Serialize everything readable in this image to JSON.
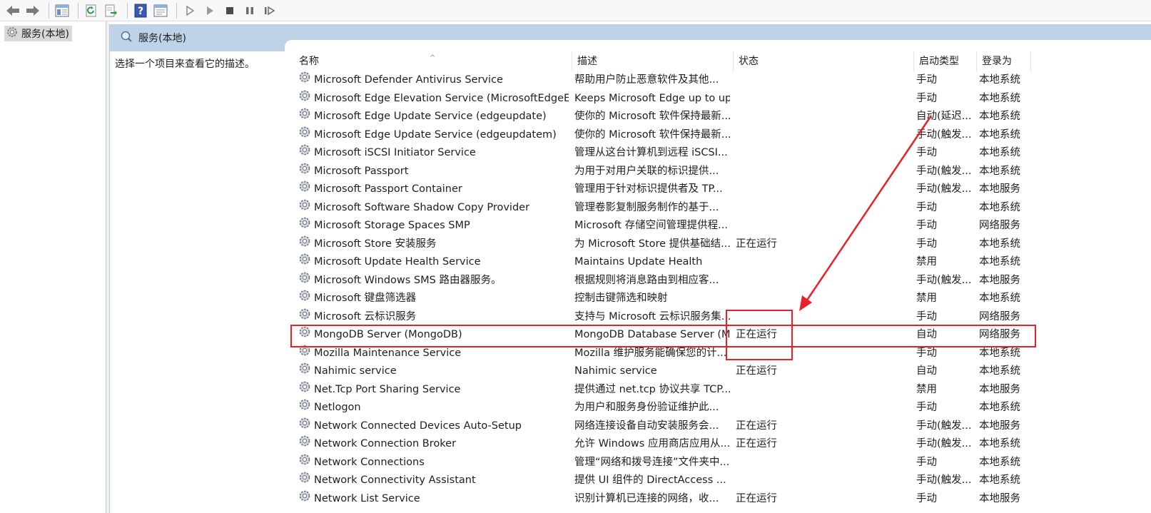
{
  "toolbar": {
    "buttons": [
      "back-icon",
      "forward-icon",
      "show-hide-tree-icon",
      "refresh-icon",
      "export-list-icon",
      "help-icon",
      "properties-icon",
      "start-icon",
      "start-alt-icon",
      "stop-icon",
      "pause-icon",
      "resume-icon"
    ]
  },
  "tree": {
    "root_label": "服务(本地)"
  },
  "panel": {
    "title": "服务(本地)",
    "description_hint": "选择一个项目来查看它的描述。"
  },
  "columns": {
    "name": "名称",
    "description": "描述",
    "status": "状态",
    "startup_type": "启动类型",
    "logon_as": "登录为"
  },
  "rows": [
    {
      "name": "Microsoft Defender Antivirus Service",
      "description": "帮助用户防止恶意软件及其他...",
      "status": "",
      "startup": "手动",
      "logon": "本地系统"
    },
    {
      "name": "Microsoft Edge Elevation Service (MicrosoftEdgeElev...",
      "description": "Keeps Microsoft Edge up to up...",
      "status": "",
      "startup": "手动",
      "logon": "本地系统"
    },
    {
      "name": "Microsoft Edge Update Service (edgeupdate)",
      "description": "使你的 Microsoft 软件保持最新...",
      "status": "",
      "startup": "自动(延迟...",
      "logon": "本地系统"
    },
    {
      "name": "Microsoft Edge Update Service (edgeupdatem)",
      "description": "使你的 Microsoft 软件保持最新...",
      "status": "",
      "startup": "手动(触发...",
      "logon": "本地系统"
    },
    {
      "name": "Microsoft iSCSI Initiator Service",
      "description": "管理从这台计算机到远程 iSCSI...",
      "status": "",
      "startup": "手动",
      "logon": "本地系统"
    },
    {
      "name": "Microsoft Passport",
      "description": "为用于对用户关联的标识提供...",
      "status": "",
      "startup": "手动(触发...",
      "logon": "本地系统"
    },
    {
      "name": "Microsoft Passport Container",
      "description": "管理用于针对标识提供者及 TP...",
      "status": "",
      "startup": "手动(触发...",
      "logon": "本地服务"
    },
    {
      "name": "Microsoft Software Shadow Copy Provider",
      "description": "管理卷影复制服务制作的基于...",
      "status": "",
      "startup": "手动",
      "logon": "本地系统"
    },
    {
      "name": "Microsoft Storage Spaces SMP",
      "description": "Microsoft 存储空间管理提供程...",
      "status": "",
      "startup": "手动",
      "logon": "网络服务"
    },
    {
      "name": "Microsoft Store 安装服务",
      "description": "为 Microsoft Store 提供基础结...",
      "status": "正在运行",
      "startup": "手动",
      "logon": "本地系统"
    },
    {
      "name": "Microsoft Update Health Service",
      "description": "Maintains Update Health",
      "status": "",
      "startup": "禁用",
      "logon": "本地系统"
    },
    {
      "name": "Microsoft Windows SMS 路由器服务。",
      "description": "根据规则将消息路由到相应客...",
      "status": "",
      "startup": "手动(触发...",
      "logon": "本地服务"
    },
    {
      "name": "Microsoft 键盘筛选器",
      "description": "控制击键筛选和映射",
      "status": "",
      "startup": "禁用",
      "logon": "本地系统"
    },
    {
      "name": "Microsoft 云标识服务",
      "description": "支持与 Microsoft 云标识服务集...",
      "status": "",
      "startup": "手动",
      "logon": "网络服务"
    },
    {
      "name": "MongoDB Server (MongoDB)",
      "description": "MongoDB Database Server (M...",
      "status": "正在运行",
      "startup": "自动",
      "logon": "网络服务"
    },
    {
      "name": "Mozilla Maintenance Service",
      "description": "Mozilla 维护服务能确保您的计...",
      "status": "",
      "startup": "手动",
      "logon": "本地系统"
    },
    {
      "name": "Nahimic service",
      "description": "Nahimic service",
      "status": "正在运行",
      "startup": "自动",
      "logon": "本地系统"
    },
    {
      "name": "Net.Tcp Port Sharing Service",
      "description": "提供通过 net.tcp 协议共享 TCP...",
      "status": "",
      "startup": "禁用",
      "logon": "本地服务"
    },
    {
      "name": "Netlogon",
      "description": "为用户和服务身份验证维护此...",
      "status": "",
      "startup": "手动",
      "logon": "本地系统"
    },
    {
      "name": "Network Connected Devices Auto-Setup",
      "description": "网络连接设备自动安装服务会...",
      "status": "正在运行",
      "startup": "手动(触发...",
      "logon": "本地服务"
    },
    {
      "name": "Network Connection Broker",
      "description": "允许 Windows 应用商店应用从...",
      "status": "正在运行",
      "startup": "手动(触发...",
      "logon": "本地系统"
    },
    {
      "name": "Network Connections",
      "description": "管理“网络和拨号连接”文件夹中...",
      "status": "",
      "startup": "手动",
      "logon": "本地系统"
    },
    {
      "name": "Network Connectivity Assistant",
      "description": "提供 UI 组件的 DirectAccess ...",
      "status": "",
      "startup": "手动(触发...",
      "logon": "本地系统"
    },
    {
      "name": "Network List Service",
      "description": "识别计算机已连接的网络，收...",
      "status": "正在运行",
      "startup": "手动",
      "logon": "本地服务"
    }
  ],
  "annotation": {
    "color": "#e8202a",
    "highlighted_row": "MongoDB Server (MongoDB)"
  }
}
